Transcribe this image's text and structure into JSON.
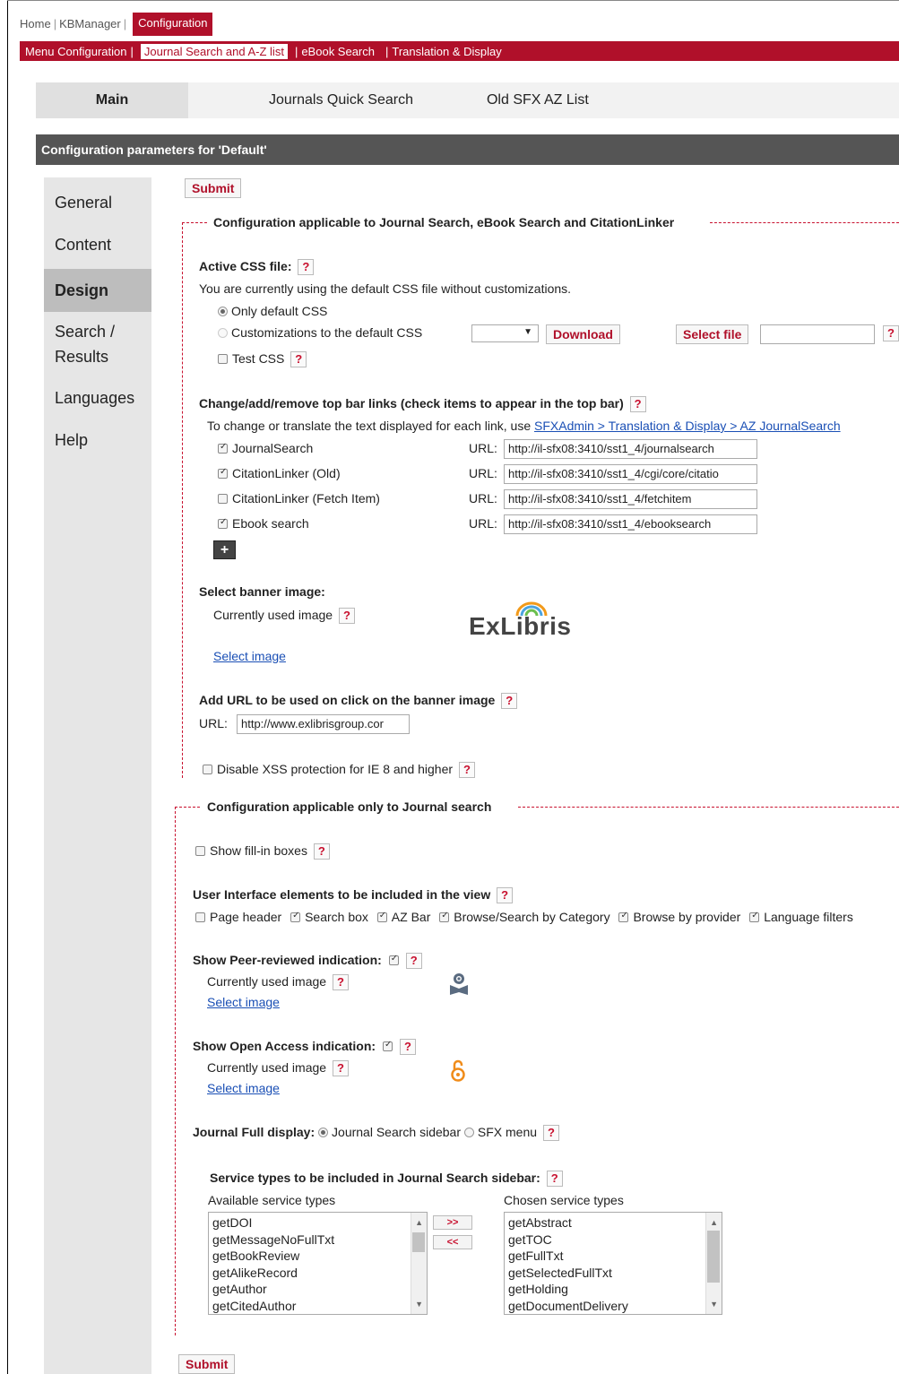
{
  "topnav": {
    "home": "Home",
    "kbmanager": "KBManager",
    "configuration": "Configuration"
  },
  "subnav": {
    "menu_configuration": "Menu Configuration",
    "journal_search": "Journal Search and A-Z list",
    "ebook_search": "eBook Search",
    "translation": "Translation & Display"
  },
  "tabs": {
    "main": "Main",
    "quick": "Journals Quick Search",
    "old": "Old SFX AZ List"
  },
  "title": "Configuration parameters for 'Default'",
  "sidebar": [
    "General",
    "Content",
    "Design",
    "Search / Results",
    "Languages",
    "Help"
  ],
  "submit_label": "Submit",
  "help_glyph": "?",
  "section1": {
    "legend": "Configuration applicable to Journal Search, eBook Search and CitationLinker",
    "css_title": "Active CSS file:",
    "css_note": "You are currently using the default CSS file without customizations.",
    "opt_default": "Only default CSS",
    "opt_custom": "Customizations to the default CSS",
    "download": "Download",
    "select_file": "Select file",
    "test_css": "Test CSS",
    "topbar_title": "Change/add/remove top bar links (check items to appear in the top bar)",
    "topbar_note_prefix": "To change or translate the text displayed for each link, use",
    "topbar_note_link": "SFXAdmin > Translation & Display > AZ JournalSearch",
    "url_label": "URL:",
    "links": [
      {
        "label": "JournalSearch",
        "checked": true,
        "url": "http://il-sfx08:3410/sst1_4/journalsearch"
      },
      {
        "label": "CitationLinker (Old)",
        "checked": true,
        "url": "http://il-sfx08:3410/sst1_4/cgi/core/citatio"
      },
      {
        "label": "CitationLinker (Fetch Item)",
        "checked": false,
        "url": "http://il-sfx08:3410/sst1_4/fetchitem"
      },
      {
        "label": "Ebook search",
        "checked": true,
        "url": "http://il-sfx08:3410/sst1_4/ebooksearch"
      }
    ],
    "plus": "+",
    "banner_title": "Select banner image:",
    "current_image": "Currently used image",
    "logo_text": "ExLibris",
    "select_image": "Select image",
    "banner_url_title": "Add URL to be used on click on the banner image",
    "banner_url_value": "http://www.exlibrisgroup.cor",
    "xss": "Disable XSS protection for IE 8 and higher"
  },
  "section2": {
    "legend": "Configuration applicable only to Journal search",
    "fill_in": "Show fill-in boxes",
    "ui_title": "User Interface elements to be included in the view",
    "ui_items": [
      {
        "label": "Page header",
        "checked": false
      },
      {
        "label": "Search box",
        "checked": true
      },
      {
        "label": "AZ Bar",
        "checked": true
      },
      {
        "label": "Browse/Search by Category",
        "checked": true
      },
      {
        "label": "Browse by provider",
        "checked": true
      },
      {
        "label": "Language filters",
        "checked": true
      }
    ],
    "peer_title": "Show Peer-reviewed indication:",
    "oa_title": "Show Open Access indication:",
    "full_display_title": "Journal Full display:",
    "opt_sidebar": "Journal Search sidebar",
    "opt_sfx": "SFX menu",
    "service_title": "Service types to be included in Journal Search sidebar:",
    "available_label": "Available service types",
    "chosen_label": "Chosen service types",
    "available": [
      "getDOI",
      "getMessageNoFullTxt",
      "getBookReview",
      "getAlikeRecord",
      "getAuthor",
      "getCitedAuthor"
    ],
    "chosen": [
      "getAbstract",
      "getTOC",
      "getFullTxt",
      "getSelectedFullTxt",
      "getHolding",
      "getDocumentDelivery"
    ],
    "move_right": ">>",
    "move_left": "<<"
  }
}
